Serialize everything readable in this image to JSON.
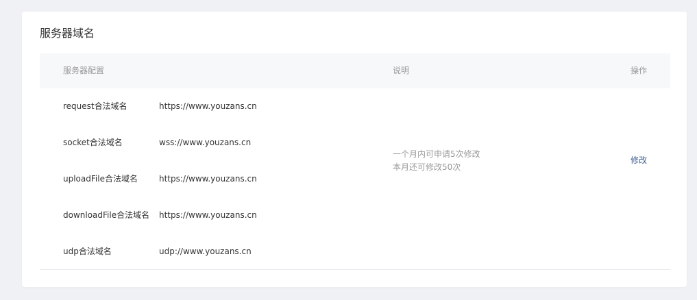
{
  "section": {
    "title": "服务器域名"
  },
  "table": {
    "headers": {
      "config": "服务器配置",
      "description": "说明",
      "operation": "操作"
    },
    "rows": [
      {
        "label": "request合法域名",
        "value": "https://www.youzans.cn"
      },
      {
        "label": "socket合法域名",
        "value": "wss://www.youzans.cn"
      },
      {
        "label": "uploadFile合法域名",
        "value": "https://www.youzans.cn"
      },
      {
        "label": "downloadFile合法域名",
        "value": "https://www.youzans.cn"
      },
      {
        "label": "udp合法域名",
        "value": "udp://www.youzans.cn"
      }
    ],
    "description": {
      "line1": "一个月内可申请5次修改",
      "line2": "本月还可修改50次"
    },
    "action_label": "修改"
  },
  "colors": {
    "background": "#f0f1f4",
    "card": "#ffffff",
    "header_bg": "#f7f8fa",
    "link": "#3f5d8a",
    "muted_text": "#999999",
    "text": "#333333"
  }
}
